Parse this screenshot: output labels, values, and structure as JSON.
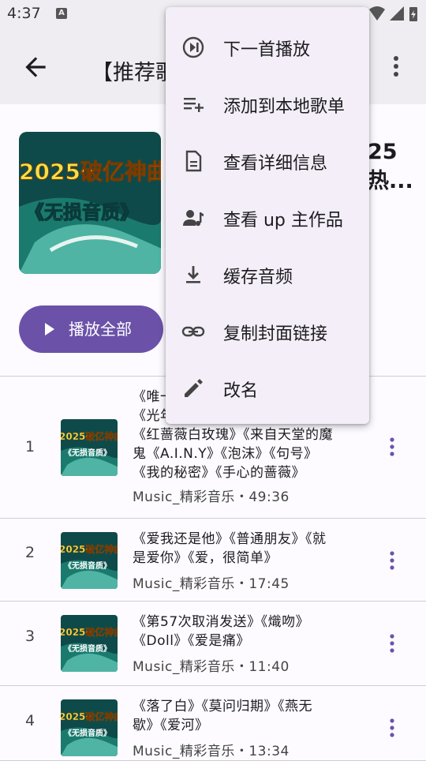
{
  "status_bar": {
    "time": "4:37",
    "badge": "A"
  },
  "top_bar": {
    "title": "【推荐歌"
  },
  "header": {
    "title": "25\n热...",
    "play_all_label": "播放全部"
  },
  "cover_art": {
    "line1": "2025破亿神曲",
    "line2": "《无损音质》"
  },
  "songs": [
    {
      "index": "1",
      "title": "《唯一》《光年之外》《告白气球》《稻香》《红蔷薇白玫瑰》《来自天堂的魔鬼《A.I.N.Y》《泡沫》《句号》《我的秘密》《手心的蔷薇》",
      "title_visible": "《唯一\n《光年之外》《告白气球》《稻香》\n《红蔷薇白玫瑰》《来自天堂的魔\n鬼《A.I.N.Y》《泡沫》《句号》\n《我的秘密》《手心的蔷薇》",
      "meta": "Music_精彩音乐・49:36"
    },
    {
      "index": "2",
      "title_visible": "《爱我还是他》《普通朋友》《就\n是爱你》《爱，很简单》",
      "meta": "Music_精彩音乐・17:45"
    },
    {
      "index": "3",
      "title_visible": "《第57次取消发送》《熾吻》\n《Doll》《爱是痛》",
      "meta": "Music_精彩音乐・11:40"
    },
    {
      "index": "4",
      "title_visible": "《落了白》《莫问归期》《燕无\n歇》《爱河》",
      "meta": "Music_精彩音乐・13:34"
    }
  ],
  "menu": [
    {
      "label": "下一首播放",
      "icon": "play-next-icon"
    },
    {
      "label": "添加到本地歌单",
      "icon": "playlist-add-icon"
    },
    {
      "label": "查看详细信息",
      "icon": "document-icon"
    },
    {
      "label": "查看 up 主作品",
      "icon": "person-music-icon"
    },
    {
      "label": "缓存音频",
      "icon": "download-icon"
    },
    {
      "label": "复制封面链接",
      "icon": "link-icon"
    },
    {
      "label": "改名",
      "icon": "edit-icon"
    }
  ],
  "colors": {
    "accent": "#6b52a8",
    "bar": "#efedf1",
    "menu_bg": "#f3eef7",
    "cover_yellow": "#f2e24a"
  }
}
